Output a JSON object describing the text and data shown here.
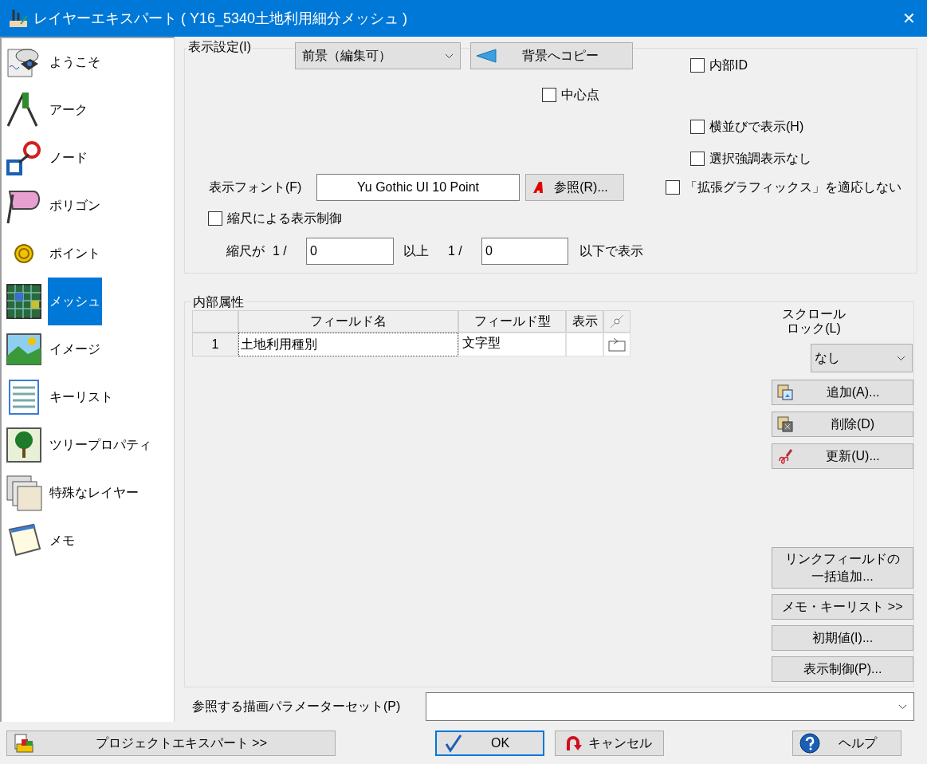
{
  "window": {
    "title": "レイヤーエキスパート ( Y16_5340土地利用細分メッシュ )",
    "close": "✕"
  },
  "sidebar": {
    "items": [
      {
        "label": "ようこそ",
        "selected": false
      },
      {
        "label": "アーク",
        "selected": false
      },
      {
        "label": "ノード",
        "selected": false
      },
      {
        "label": "ポリゴン",
        "selected": false
      },
      {
        "label": "ポイント",
        "selected": false
      },
      {
        "label": "メッシュ",
        "selected": true
      },
      {
        "label": "イメージ",
        "selected": false
      },
      {
        "label": "キーリスト",
        "selected": false
      },
      {
        "label": "ツリープロパティ",
        "selected": false
      },
      {
        "label": "特殊なレイヤー",
        "selected": false
      },
      {
        "label": "メモ",
        "selected": false
      }
    ]
  },
  "display_settings": {
    "legend": "表示設定(I)",
    "mode_dropdown": {
      "value": "前景（編集可）"
    },
    "copy_button": "背景へコピー",
    "internal_id": {
      "label": "内部ID",
      "checked": false
    },
    "center_point": {
      "label": "中心点",
      "checked": false
    },
    "side_by_side": {
      "label": "横並びで表示(H)",
      "checked": false
    },
    "no_selection_highlight": {
      "label": "選択強調表示なし",
      "checked": false
    },
    "font_label": "表示フォント(F)",
    "font_value": "Yu Gothic UI 10 Point",
    "browse_button": "参照(R)...",
    "no_extended_graphics": {
      "label": "「拡張グラフィックス」を適応しない",
      "checked": false
    },
    "scale_control": {
      "label": "縮尺による表示制御",
      "checked": false
    },
    "scale_row": {
      "prefix": "縮尺が",
      "ratio_1": "1 /",
      "min": "0",
      "middle": "以上",
      "ratio_2": "1 /",
      "max": "0",
      "suffix": "以下で表示"
    }
  },
  "internal_attributes": {
    "legend": "内部属性",
    "table": {
      "columns": [
        "フィールド名",
        "フィールド型",
        "表示"
      ],
      "rows": [
        {
          "number": "1",
          "name": "土地利用種別",
          "type": "文字型"
        }
      ]
    },
    "scroll_lock": {
      "label_lines": [
        "スクロール",
        "ロック(L)"
      ],
      "value": "なし"
    },
    "buttons": [
      {
        "label": "追加(A)...",
        "kind": "add"
      },
      {
        "label": "削除(D)",
        "kind": "delete"
      },
      {
        "label": "更新(U)...",
        "kind": "update"
      }
    ],
    "lower_buttons": [
      {
        "lines": [
          "リンクフィールドの",
          "一括追加..."
        ]
      },
      {
        "lines": [
          "メモ・キーリスト >>"
        ]
      },
      {
        "lines": [
          "初期値(I)..."
        ]
      },
      {
        "lines": [
          "表示制御(P)..."
        ]
      }
    ]
  },
  "parameter_set": {
    "label": "参照する描画パラメーターセット(P)"
  },
  "footer": {
    "buttons": [
      {
        "label": "プロジェクトエキスパート >>",
        "kind": "project",
        "default": false
      },
      {
        "label": "OK",
        "kind": "ok",
        "default": true
      },
      {
        "label": "キャンセル",
        "kind": "cancel",
        "default": false
      },
      {
        "label": "ヘルプ",
        "kind": "help",
        "default": false
      }
    ]
  }
}
